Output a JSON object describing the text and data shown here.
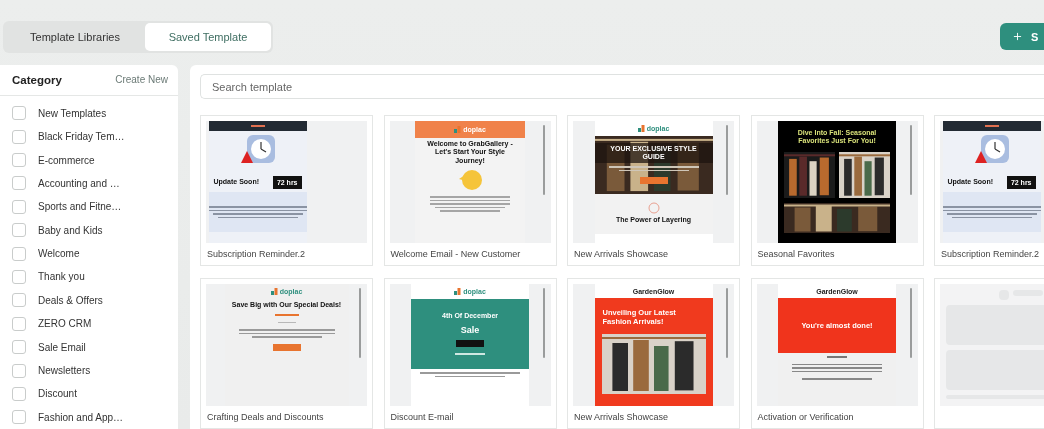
{
  "tabs": [
    {
      "label": "Template Libraries",
      "selected": false
    },
    {
      "label": "Saved Template",
      "selected": true
    }
  ],
  "action_button": {
    "label": "S"
  },
  "sidebar": {
    "title": "Category",
    "create_link": "Create New",
    "items": [
      {
        "label": "New Templates",
        "checked": false
      },
      {
        "label": "Black Friday Tem…",
        "checked": false
      },
      {
        "label": "E-commerce",
        "checked": false
      },
      {
        "label": "Accounting and …",
        "checked": false
      },
      {
        "label": "Sports and Fitne…",
        "checked": false
      },
      {
        "label": "Baby and Kids",
        "checked": false
      },
      {
        "label": "Welcome",
        "checked": false
      },
      {
        "label": "Thank you",
        "checked": false
      },
      {
        "label": "Deals & Offers",
        "checked": false
      },
      {
        "label": "ZERO CRM",
        "checked": false
      },
      {
        "label": "Sale Email",
        "checked": false
      },
      {
        "label": "Newsletters",
        "checked": false
      },
      {
        "label": "Discount",
        "checked": false
      },
      {
        "label": "Fashion and App…",
        "checked": false
      }
    ]
  },
  "search": {
    "placeholder": "Search template"
  },
  "templates": [
    {
      "name": "Subscription Reminder.2",
      "preview": {
        "kind": "alert",
        "headline": "Update Soon!",
        "badge": "72 hrs"
      }
    },
    {
      "name": "Welcome Email - New Customer",
      "preview": {
        "kind": "welcome",
        "brand": "doplac",
        "headline": "Welcome to GrabGallery - Let's Start Your Style Journey!"
      }
    },
    {
      "name": "New Arrivals Showcase",
      "preview": {
        "kind": "guide",
        "brand": "doplac",
        "headline": "YOUR EXCLUSIVE STYLE GUIDE",
        "footer": "The Power of Layering"
      }
    },
    {
      "name": "Seasonal Favorites",
      "preview": {
        "kind": "seasonal",
        "headline": "Dive Into Fall: Seasonal Favorites Just For You!"
      }
    },
    {
      "name": "Subscription Reminder.2",
      "preview": {
        "kind": "alert",
        "headline": "Update Soon!",
        "badge": "72 hrs"
      }
    },
    {
      "name": "Crafting Deals and Discounts",
      "preview": {
        "kind": "deals",
        "brand": "doplac",
        "headline": "Save Big with Our Special Deals!"
      }
    },
    {
      "name": "Discount E-mail",
      "preview": {
        "kind": "sale",
        "brand": "doplac",
        "kicker": "4th Of December",
        "headline": "Sale"
      }
    },
    {
      "name": "New Arrivals Showcase",
      "preview": {
        "kind": "fashion",
        "brand": "GardenGlow",
        "headline": "Unveiling Our Latest Fashion Arrivals!"
      }
    },
    {
      "name": "Activation or Verification",
      "preview": {
        "kind": "verify",
        "brand": "GardenGlow",
        "headline": "You're almost done!"
      }
    },
    {
      "preview": {
        "kind": "skeleton"
      }
    }
  ]
}
